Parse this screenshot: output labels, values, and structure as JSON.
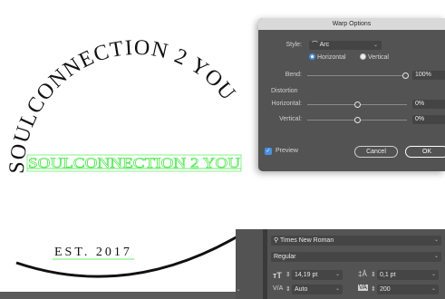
{
  "artwork": {
    "arc_text": "SOULCONNECTION 2 YOU",
    "flat_text": "SOULCONNECTION 2 YOU",
    "est_text": "EST. 2017",
    "arc_text_color": "#111111",
    "flat_text_color": "#39e639",
    "selection_color": "#39e639"
  },
  "warp_dialog": {
    "title": "Warp Options",
    "style_label": "Style:",
    "style_value": "Arc",
    "orientation_horizontal": "Horizontal",
    "orientation_vertical": "Vertical",
    "selected_orientation": "horizontal",
    "bend_label": "Bend:",
    "bend_value": "100%",
    "distortion_label": "Distortion",
    "horizontal_label": "Horizontal:",
    "horizontal_value": "0%",
    "vertical_label": "Vertical:",
    "vertical_value": "0%",
    "preview_label": "Preview",
    "preview_checked": true,
    "cancel_label": "Cancel",
    "ok_label": "OK"
  },
  "character_panel": {
    "font_family": "Times New Roman",
    "font_style": "Regular",
    "font_size": "14,19 pt",
    "leading": "0,1 pt",
    "kerning": "Auto",
    "tracking": "200"
  }
}
